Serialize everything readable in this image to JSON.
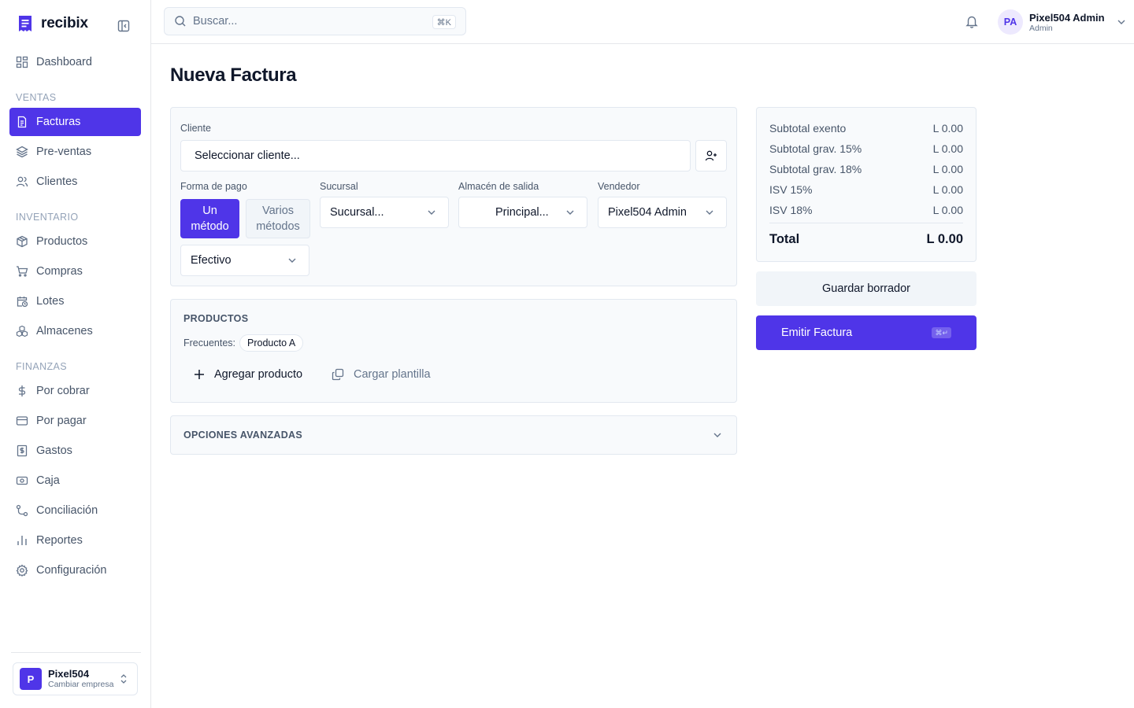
{
  "app": {
    "name": "recibix"
  },
  "sidebar": {
    "items_top": [
      {
        "label": "Dashboard",
        "icon": "dashboard-icon"
      }
    ],
    "sections": [
      {
        "title": "VENTAS",
        "items": [
          {
            "label": "Facturas",
            "icon": "document-icon",
            "active": true
          },
          {
            "label": "Pre-ventas",
            "icon": "layers-icon"
          },
          {
            "label": "Clientes",
            "icon": "users-icon"
          }
        ]
      },
      {
        "title": "INVENTARIO",
        "items": [
          {
            "label": "Productos",
            "icon": "box-icon"
          },
          {
            "label": "Compras",
            "icon": "cart-icon"
          },
          {
            "label": "Lotes",
            "icon": "calendar-clock-icon"
          },
          {
            "label": "Almacenes",
            "icon": "boxes-icon"
          }
        ]
      },
      {
        "title": "FINANZAS",
        "items": [
          {
            "label": "Por cobrar",
            "icon": "dollar-icon"
          },
          {
            "label": "Por pagar",
            "icon": "credit-card-icon"
          },
          {
            "label": "Gastos",
            "icon": "receipt-icon"
          },
          {
            "label": "Caja",
            "icon": "banknote-icon"
          },
          {
            "label": "Conciliación",
            "icon": "git-compare-icon"
          },
          {
            "label": "Reportes",
            "icon": "bar-chart-icon"
          },
          {
            "label": "Configuración",
            "icon": "gear-icon"
          }
        ]
      }
    ],
    "company": {
      "initial": "P",
      "name": "Pixel504",
      "subtitle": "Cambiar empresa"
    }
  },
  "topbar": {
    "search_placeholder": "Buscar...",
    "search_shortcut": "⌘K",
    "user": {
      "initials": "PA",
      "name": "Pixel504 Admin",
      "role": "Admin"
    }
  },
  "page": {
    "title": "Nueva Factura"
  },
  "form": {
    "cliente_label": "Cliente",
    "cliente_value": "Seleccionar cliente...",
    "forma_pago_label": "Forma de pago",
    "seg_single": [
      "Un",
      "método"
    ],
    "seg_multi": [
      "Varios",
      "métodos"
    ],
    "metodo_value": "Efectivo",
    "sucursal_label": "Sucursal",
    "sucursal_value": "Sucursal...",
    "almacen_label": "Almacén de salida",
    "almacen_value": "Principal...",
    "vendedor_label": "Vendedor",
    "vendedor_value": "Pixel504 Admin"
  },
  "productos": {
    "heading": "PRODUCTOS",
    "frecuentes_label": "Frecuentes:",
    "frecuentes": [
      "Producto A"
    ],
    "add_label": "Agregar producto",
    "template_label": "Cargar plantilla"
  },
  "avanzadas": {
    "heading": "OPCIONES AVANZADAS"
  },
  "totals": {
    "rows": [
      {
        "label": "Subtotal exento",
        "value": "L 0.00"
      },
      {
        "label": "Subtotal grav. 15%",
        "value": "L 0.00"
      },
      {
        "label": "Subtotal grav. 18%",
        "value": "L 0.00"
      },
      {
        "label": "ISV 15%",
        "value": "L 0.00"
      },
      {
        "label": "ISV 18%",
        "value": "L 0.00"
      }
    ],
    "total_label": "Total",
    "total_value": "L 0.00"
  },
  "actions": {
    "draft_label": "Guardar borrador",
    "emit_label": "Emitir Factura",
    "emit_shortcut": "⌘↵"
  },
  "colors": {
    "accent": "#4f35e8",
    "card_bg": "#f8fafc",
    "border": "#e2e8f0"
  }
}
